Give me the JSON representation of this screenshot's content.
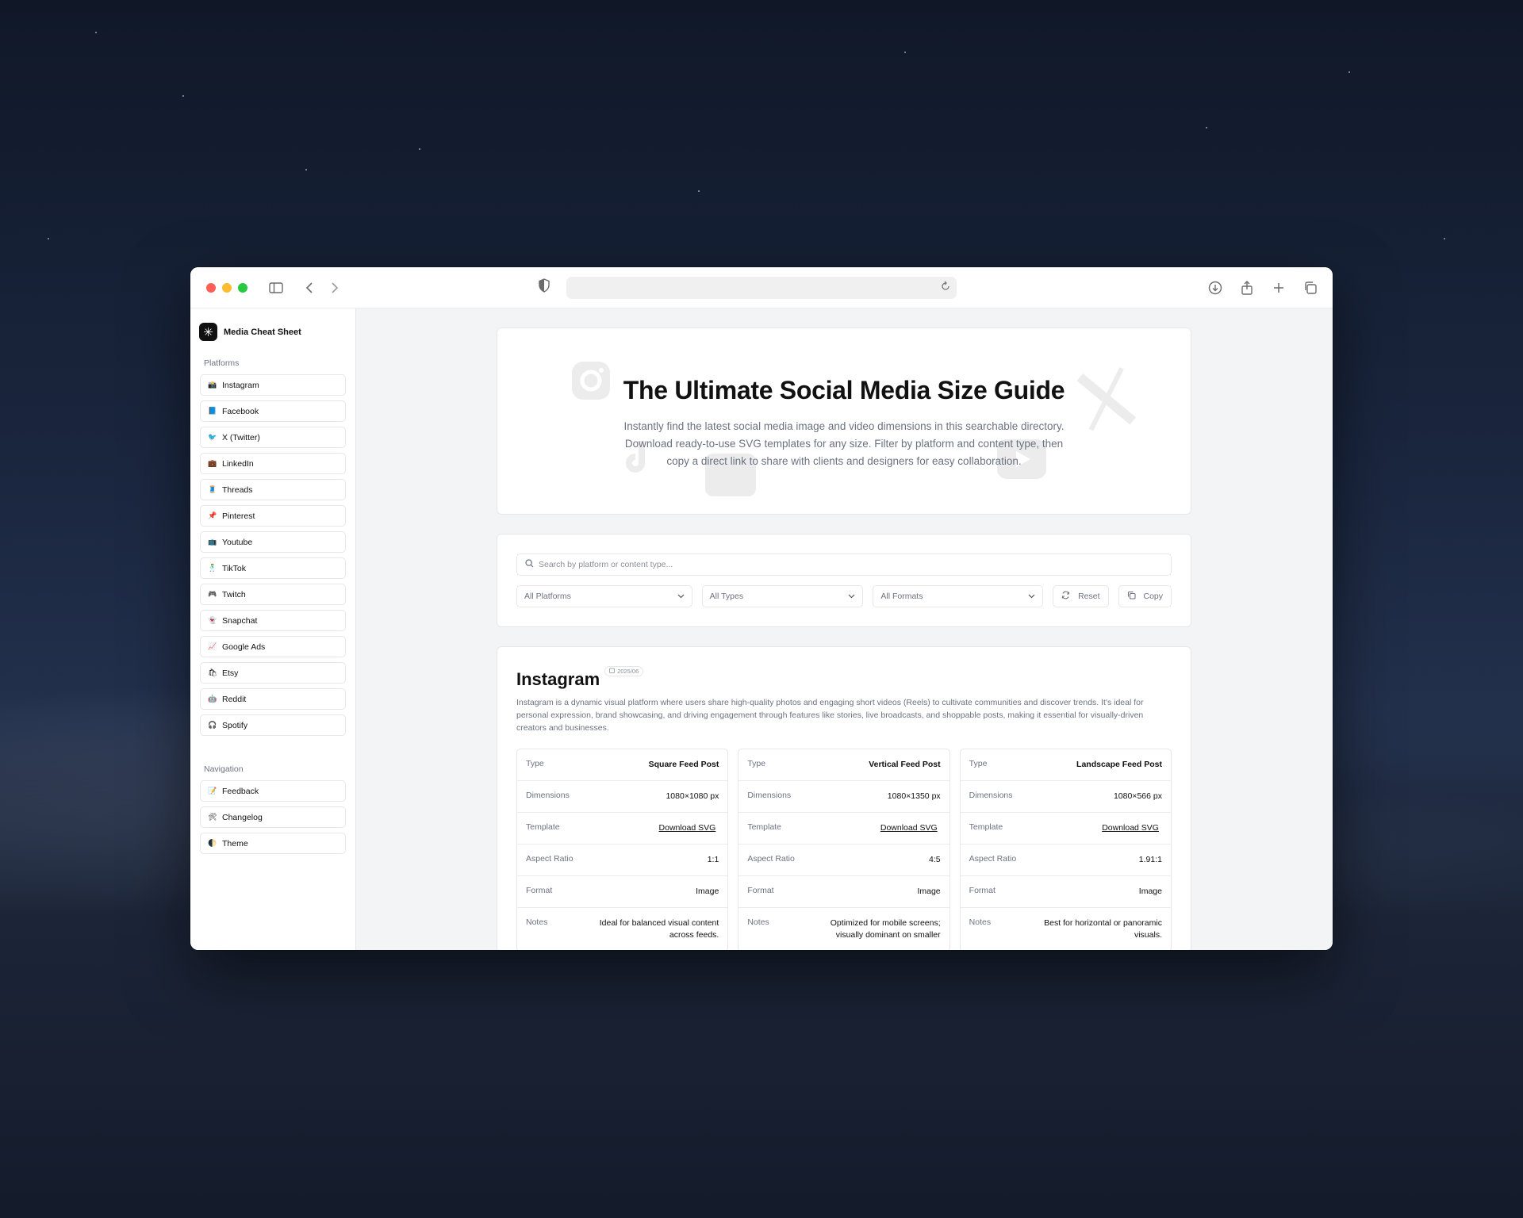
{
  "app": {
    "brand": "Media Cheat Sheet"
  },
  "sidebar": {
    "platforms_label": "Platforms",
    "platforms": [
      {
        "icon": "📸",
        "label": "Instagram"
      },
      {
        "icon": "📘",
        "label": "Facebook"
      },
      {
        "icon": "🐦",
        "label": "X (Twitter)"
      },
      {
        "icon": "💼",
        "label": "LinkedIn"
      },
      {
        "icon": "🧵",
        "label": "Threads"
      },
      {
        "icon": "📌",
        "label": "Pinterest"
      },
      {
        "icon": "📺",
        "label": "Youtube"
      },
      {
        "icon": "🕺",
        "label": "TikTok"
      },
      {
        "icon": "🎮",
        "label": "Twitch"
      },
      {
        "icon": "👻",
        "label": "Snapchat"
      },
      {
        "icon": "📈",
        "label": "Google Ads"
      },
      {
        "icon": "🛍",
        "label": "Etsy"
      },
      {
        "icon": "🤖",
        "label": "Reddit"
      },
      {
        "icon": "🎧",
        "label": "Spotify"
      }
    ],
    "navigation_label": "Navigation",
    "navigation": [
      {
        "icon": "📝",
        "label": "Feedback"
      },
      {
        "icon": "🛠",
        "label": "Changelog"
      },
      {
        "icon": "🌓",
        "label": "Theme"
      }
    ]
  },
  "hero": {
    "title": "The Ultimate Social Media Size Guide",
    "description": "Instantly find the latest social media image and video dimensions in this searchable directory. Download ready-to-use SVG templates for any size. Filter by platform and content type, then copy a direct link to share with clients and designers for easy collaboration."
  },
  "filters": {
    "search_placeholder": "Search by platform or content type...",
    "platforms_select": "All Platforms",
    "types_select": "All Types",
    "formats_select": "All Formats",
    "reset_label": "Reset",
    "copy_label": "Copy"
  },
  "platform": {
    "name": "Instagram",
    "date": "2025/06",
    "description": "Instagram is a dynamic visual platform where users share high-quality photos and engaging short videos (Reels) to cultivate communities and discover trends. It's ideal for personal expression, brand showcasing, and driving engagement through features like stories, live broadcasts, and shoppable posts, making it essential for visually-driven creators and businesses.",
    "labels": {
      "type": "Type",
      "dimensions": "Dimensions",
      "template": "Template",
      "aspect_ratio": "Aspect Ratio",
      "format": "Format",
      "notes": "Notes"
    },
    "specs": [
      {
        "type": "Square Feed Post",
        "dimensions": "1080×1080 px",
        "template": "Download SVG",
        "aspect_ratio": "1:1",
        "format": "Image",
        "notes": "Ideal for balanced visual content across feeds."
      },
      {
        "type": "Vertical Feed Post",
        "dimensions": "1080×1350 px",
        "template": "Download SVG",
        "aspect_ratio": "4:5",
        "format": "Image",
        "notes": "Optimized for mobile screens; visually dominant on smaller"
      },
      {
        "type": "Landscape Feed Post",
        "dimensions": "1080×566 px",
        "template": "Download SVG",
        "aspect_ratio": "1.91:1",
        "format": "Image",
        "notes": "Best for horizontal or panoramic visuals."
      }
    ]
  }
}
